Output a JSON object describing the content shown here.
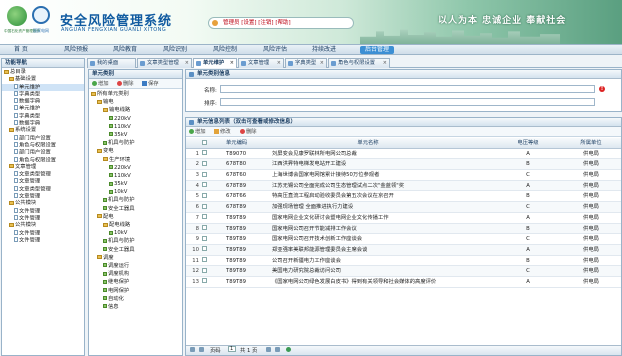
{
  "header": {
    "logo_left_caption": "中国石化资产管理股份",
    "logo_right_caption": "国家电网",
    "title": "安全风险管理系统",
    "subtitle": "ANGUAN FENGXIAN GUANLI XITONG",
    "user_bar": "管理员 [设置] [注销] [帮助]",
    "slogan": "以人为本  忠诚企业  奉献社会"
  },
  "nav": {
    "items": [
      "首  页",
      "风险预报",
      "风险教育",
      "风险识别",
      "风险控制",
      "风险评估",
      "持续改进",
      "后台管理"
    ],
    "active": "后台管理"
  },
  "left_panel": {
    "title": "功能导航",
    "tree": [
      {
        "label": "总目录",
        "level": 0,
        "icon": "folder"
      },
      {
        "label": "基础设置",
        "level": 1,
        "icon": "folder"
      },
      {
        "label": "单元维护",
        "level": 2,
        "icon": "doc"
      },
      {
        "label": "字典类型",
        "level": 2,
        "icon": "doc"
      },
      {
        "label": "数据字典",
        "level": 2,
        "icon": "doc"
      },
      {
        "label": "单元维护",
        "level": 2,
        "icon": "doc"
      },
      {
        "label": "字典类型",
        "level": 2,
        "icon": "doc"
      },
      {
        "label": "数据字典",
        "level": 2,
        "icon": "doc"
      },
      {
        "label": "系统设置",
        "level": 1,
        "icon": "folder"
      },
      {
        "label": "部门用户设置",
        "level": 2,
        "icon": "doc"
      },
      {
        "label": "角色与权限设置",
        "level": 2,
        "icon": "doc"
      },
      {
        "label": "部门用户设置",
        "level": 2,
        "icon": "doc"
      },
      {
        "label": "角色与权限设置",
        "level": 2,
        "icon": "doc"
      },
      {
        "label": "文章管理",
        "level": 1,
        "icon": "folder"
      },
      {
        "label": "文章类型管理",
        "level": 2,
        "icon": "doc"
      },
      {
        "label": "文章管理",
        "level": 2,
        "icon": "doc"
      },
      {
        "label": "文章类型管理",
        "level": 2,
        "icon": "doc"
      },
      {
        "label": "文章管理",
        "level": 2,
        "icon": "doc"
      },
      {
        "label": "公共模块",
        "level": 1,
        "icon": "folder"
      },
      {
        "label": "文件管理",
        "level": 2,
        "icon": "doc"
      },
      {
        "label": "文件管理",
        "level": 2,
        "icon": "doc"
      },
      {
        "label": "公共模块",
        "level": 1,
        "icon": "folder"
      },
      {
        "label": "文件管理",
        "level": 2,
        "icon": "doc"
      },
      {
        "label": "文件管理",
        "level": 2,
        "icon": "doc"
      }
    ]
  },
  "tabs": [
    {
      "label": "我的桌面",
      "active": false
    },
    {
      "label": "文章类型管理",
      "active": false
    },
    {
      "label": "单元维护",
      "active": true
    },
    {
      "label": "文章管理",
      "active": false
    },
    {
      "label": "字典类型",
      "active": false
    },
    {
      "label": "角色与权限设置",
      "active": false
    }
  ],
  "category_panel": {
    "title": "单元类别",
    "toolbar": {
      "add": "增加",
      "delete": "删除",
      "save": "保存"
    },
    "tree": [
      {
        "label": "所有单元类别",
        "level": 0,
        "icon": "folder"
      },
      {
        "label": "输电",
        "level": 1,
        "icon": "folder"
      },
      {
        "label": "输电线路",
        "level": 2,
        "icon": "folder"
      },
      {
        "label": "220kV",
        "level": 3,
        "icon": "leaf"
      },
      {
        "label": "110kV",
        "level": 3,
        "icon": "leaf"
      },
      {
        "label": "35kV",
        "level": 3,
        "icon": "leaf"
      },
      {
        "label": "机具与防护",
        "level": 2,
        "icon": "leaf"
      },
      {
        "label": "变电",
        "level": 1,
        "icon": "folder"
      },
      {
        "label": "生产环境",
        "level": 2,
        "icon": "folder"
      },
      {
        "label": "220kV",
        "level": 3,
        "icon": "leaf"
      },
      {
        "label": "110kV",
        "level": 3,
        "icon": "leaf"
      },
      {
        "label": "35kV",
        "level": 3,
        "icon": "leaf"
      },
      {
        "label": "10kV",
        "level": 3,
        "icon": "leaf"
      },
      {
        "label": "机具与防护",
        "level": 2,
        "icon": "leaf"
      },
      {
        "label": "安全工器具",
        "level": 2,
        "icon": "leaf"
      },
      {
        "label": "配电",
        "level": 1,
        "icon": "folder"
      },
      {
        "label": "配电线路",
        "level": 2,
        "icon": "folder"
      },
      {
        "label": "10kV",
        "level": 3,
        "icon": "leaf"
      },
      {
        "label": "机具与防护",
        "level": 2,
        "icon": "leaf"
      },
      {
        "label": "安全工器具",
        "level": 2,
        "icon": "leaf"
      },
      {
        "label": "调度",
        "level": 1,
        "icon": "folder"
      },
      {
        "label": "调度运行",
        "level": 2,
        "icon": "leaf"
      },
      {
        "label": "调度机构",
        "level": 2,
        "icon": "leaf"
      },
      {
        "label": "继电保护",
        "level": 2,
        "icon": "leaf"
      },
      {
        "label": "电网保护",
        "level": 2,
        "icon": "leaf"
      },
      {
        "label": "自动化",
        "level": 2,
        "icon": "leaf"
      },
      {
        "label": "信息",
        "level": 2,
        "icon": "leaf"
      }
    ]
  },
  "info_panel": {
    "title": "单元类别信息",
    "name_label": "名称:",
    "order_label": "排序:",
    "name_value": "",
    "order_value": ""
  },
  "list_panel": {
    "title": "单元信息列表（双击可查看或修改信息）",
    "toolbar": {
      "add": "增加",
      "edit": "修改",
      "delete": "删除"
    },
    "columns": [
      "单元编码",
      "单元名称",
      "电压等级",
      "所属单位"
    ],
    "rows": [
      {
        "num": "1",
        "code": "T89070",
        "name": "刘屏变会见康罗联林所电网公司总裁",
        "level": "A",
        "unit": "供电局"
      },
      {
        "num": "2",
        "code": "678T80",
        "name": "江西洪昇特电梯发电站开工建设",
        "level": "B",
        "unit": "供电局"
      },
      {
        "num": "3",
        "code": "678T60",
        "name": "上海世博会国家电网馆累计接待50万位参观者",
        "level": "C",
        "unit": "供电局"
      },
      {
        "num": "4",
        "code": "678T89",
        "name": "江苏无锡公司全面完成公司生态管理试点二次\"金蓝领\"奖",
        "level": "A",
        "unit": "供电局"
      },
      {
        "num": "5",
        "code": "678T66",
        "name": "特高压直流工程启动验收委员会第五次会议在京召开",
        "level": "B",
        "unit": "供电局"
      },
      {
        "num": "6",
        "code": "678T89",
        "name": "加强现场管理 全面推进执行力建设",
        "level": "C",
        "unit": "供电局"
      },
      {
        "num": "7",
        "code": "T89T89",
        "name": "国家电网企业文化研讨会暨电网企业文化传播工作",
        "level": "A",
        "unit": "供电局"
      },
      {
        "num": "8",
        "code": "T89T89",
        "name": "国家电网公司召开节能减排工作会议",
        "level": "B",
        "unit": "供电局"
      },
      {
        "num": "9",
        "code": "T89T89",
        "name": "国家电网公司召开技术创新工作座谈会",
        "level": "C",
        "unit": "供电局"
      },
      {
        "num": "10",
        "code": "T89T89",
        "name": "郑亚强率美联邦能源管理委员会主席会谈",
        "level": "A",
        "unit": "供电局"
      },
      {
        "num": "11",
        "code": "T89T89",
        "name": "公司召开新疆电力工作座谈会",
        "level": "B",
        "unit": "供电局"
      },
      {
        "num": "12",
        "code": "T89T89",
        "name": "美国电力研究院总裁访问公司",
        "level": "C",
        "unit": "供电局"
      },
      {
        "num": "13",
        "code": "T89T89",
        "name": "《国家电网公司绿色发展白皮书》得到有关领导和社会媒体的高度评价",
        "level": "A",
        "unit": "供电局"
      }
    ],
    "pager": {
      "prefix": "页码",
      "page": "1",
      "suffix": "共 1 页"
    }
  },
  "colors": {
    "nav_active": "#3c8fd4",
    "header_title": "#0f5aa0",
    "panel_border": "#99b3c9"
  }
}
